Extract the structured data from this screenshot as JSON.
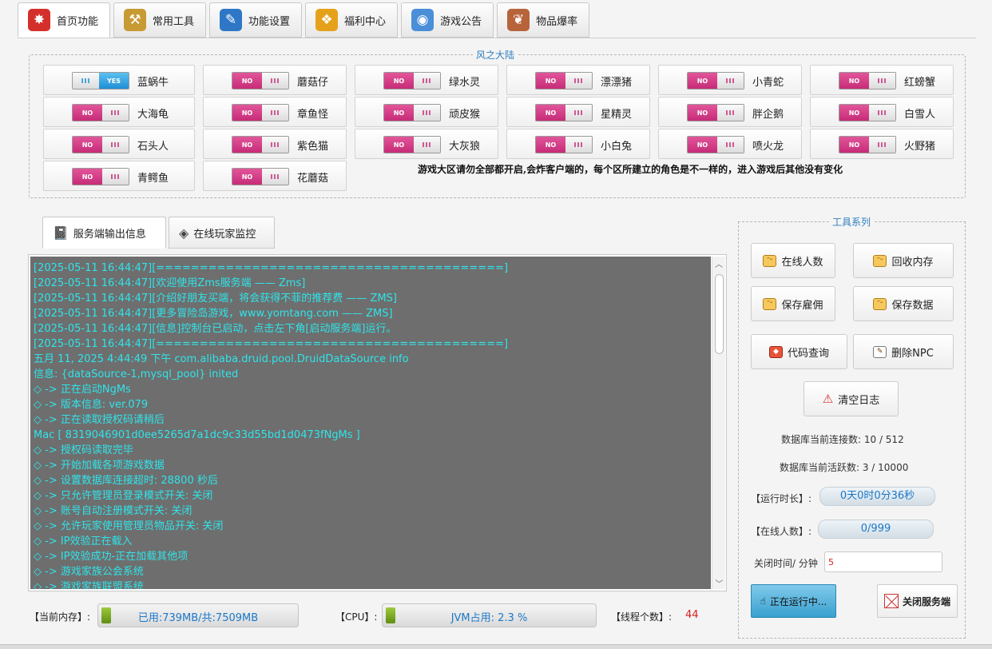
{
  "tabs": [
    {
      "label": "首页功能",
      "icon": "home-star-icon",
      "color": "#d4302b"
    },
    {
      "label": "常用工具",
      "icon": "tools-bag-icon",
      "color": "#c79a33"
    },
    {
      "label": "功能设置",
      "icon": "wrench-settings-icon",
      "color": "#2f77c6"
    },
    {
      "label": "福利中心",
      "icon": "gift-box-icon",
      "color": "#e6a11b"
    },
    {
      "label": "游戏公告",
      "icon": "megaphone-icon",
      "color": "#4a8fd8"
    },
    {
      "label": "物品爆率",
      "icon": "scroll-icon",
      "color": "#b8643b"
    }
  ],
  "region": {
    "title": "风之大陆",
    "note": "游戏大区请勿全部都开启,会炸客户端的，每个区所建立的角色是不一样的，进入游戏后其他没有变化",
    "toggle_on_text": "YES",
    "toggle_off_text": "NO",
    "grip_text": "III",
    "maps": [
      {
        "name": "蓝蜗牛",
        "on": true
      },
      {
        "name": "蘑菇仔",
        "on": false
      },
      {
        "name": "绿水灵",
        "on": false
      },
      {
        "name": "漂漂猪",
        "on": false
      },
      {
        "name": "小青蛇",
        "on": false
      },
      {
        "name": "红螃蟹",
        "on": false
      },
      {
        "name": "大海龟",
        "on": false
      },
      {
        "name": "章鱼怪",
        "on": false
      },
      {
        "name": "顽皮猴",
        "on": false
      },
      {
        "name": "星精灵",
        "on": false
      },
      {
        "name": "胖企鹅",
        "on": false
      },
      {
        "name": "白雪人",
        "on": false
      },
      {
        "name": "石头人",
        "on": false
      },
      {
        "name": "紫色猫",
        "on": false
      },
      {
        "name": "大灰狼",
        "on": false
      },
      {
        "name": "小白兔",
        "on": false
      },
      {
        "name": "喷火龙",
        "on": false
      },
      {
        "name": "火野猪",
        "on": false
      },
      {
        "name": "青鳄鱼",
        "on": false
      },
      {
        "name": "花蘑菇",
        "on": false
      }
    ]
  },
  "console_tabs": [
    {
      "label": "服务端输出信息",
      "icon": "notebook-icon"
    },
    {
      "label": "在线玩家监控",
      "icon": "monitor-diamond-icon"
    }
  ],
  "console": {
    "lines": [
      "[2025-05-11 16:44:47][========================================]",
      "[2025-05-11 16:44:47][欢迎使用Zms服务端 —— Zms]",
      "[2025-05-11 16:44:47][介绍好朋友买端，将会获得不菲的推荐费 —— ZMS]",
      "[2025-05-11 16:44:47][更多冒险岛游戏，www.yomtang.com —— ZMS]",
      "[2025-05-11 16:44:47][信息]控制台已启动，点击左下角[启动服务端]运行。",
      "[2025-05-11 16:44:47][========================================]",
      "五月 11, 2025 4:44:49 下午 com.alibaba.druid.pool.DruidDataSource info",
      "信息: {dataSource-1,mysql_pool} inited",
      "◇ -> 正在启动NgMs",
      "◇ -> 版本信息: ver.079",
      "◇ -> 正在读取授权码请稍后",
      "Mac [ 8319046901d0ee5265d7a1dc9c33d55bd1d0473fNgMs ]",
      "◇ -> 授权码读取完毕",
      "◇ -> 开始加载各项游戏数据",
      "◇ -> 设置数据库连接超时: 28800 秒后",
      "◇ -> 只允许管理员登录模式开关: 关闭",
      "◇ -> 账号自动注册模式开关: 关闭",
      "◇ -> 允许玩家使用管理员物品开关: 关闭",
      "◇ -> IP效验正在载入",
      "◇ -> IP效验成功-正在加载其他项",
      "◇ -> 游戏家族公会系统",
      "◇ -> 游戏家族联盟系统"
    ]
  },
  "status": {
    "memory_label": "【当前内存】:",
    "memory_text": "已用:739MB/共:7509MB",
    "cpu_label": "【CPU】:",
    "cpu_text": "JVM占用:  2.3 %",
    "threads_label": "【线程个数】:",
    "threads_value": "44"
  },
  "tools": {
    "title": "工具系列",
    "buttons": [
      {
        "label": "在线人数",
        "icon": "face-icon"
      },
      {
        "label": "回收内存",
        "icon": "face-icon"
      },
      {
        "label": "保存雇佣",
        "icon": "face-icon"
      },
      {
        "label": "保存数据",
        "icon": "face-icon"
      },
      {
        "label": "代码查询",
        "icon": "cube-icon"
      },
      {
        "label": "删除NPC",
        "icon": "document-icon"
      }
    ],
    "clear_log": "清空日志",
    "db_conn": "数据库当前连接数: 10 / 512",
    "db_active": "数据库当前活跃数: 3 / 10000",
    "uptime_label": "【运行时长】:",
    "uptime_value": "0天0时0分36秒",
    "online_label": "【在线人数】:",
    "online_value": "0/999",
    "close_time_label": "关闭时间/ 分钟",
    "close_time_value": "5",
    "running_label": "正在运行中...",
    "stop_label": "关闭服务端"
  }
}
